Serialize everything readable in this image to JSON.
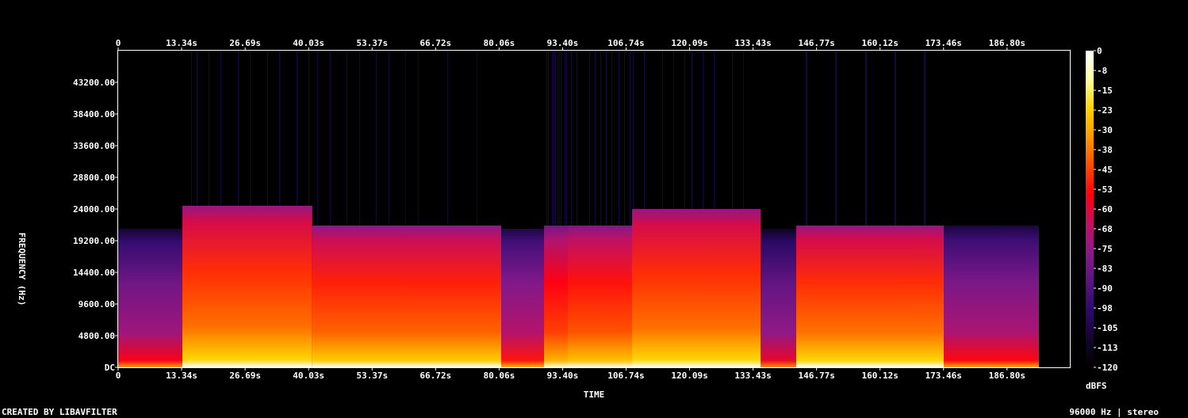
{
  "chart_data": {
    "type": "heatmap",
    "title": "",
    "xlabel": "TIME",
    "ylabel": "FREQUENCY (Hz)",
    "x_ticks": [
      "0",
      "13.34s",
      "26.69s",
      "40.03s",
      "53.37s",
      "66.72s",
      "80.06s",
      "93.40s",
      "106.74s",
      "120.09s",
      "133.43s",
      "146.77s",
      "160.12s",
      "173.46s",
      "186.80s"
    ],
    "y_ticks": [
      "DC",
      "4800.00",
      "9600.00",
      "14400.00",
      "19200.00",
      "24000.00",
      "28800.00",
      "33600.00",
      "38400.00",
      "43200.00"
    ],
    "xlim": [
      0,
      200
    ],
    "ylim": [
      0,
      48000
    ],
    "colorbar": {
      "label": "dBFS",
      "ticks": [
        "0",
        "-8",
        "-15",
        "-23",
        "-30",
        "-38",
        "-45",
        "-53",
        "-60",
        "-68",
        "-75",
        "-83",
        "-90",
        "-98",
        "-105",
        "-113",
        "-120"
      ],
      "range": [
        -120,
        0
      ],
      "colormap": [
        "#000000",
        "#14052e",
        "#2e0a6e",
        "#5a1480",
        "#8a1a8a",
        "#c41060",
        "#ff0010",
        "#ff4a00",
        "#ff9a00",
        "#ffd400",
        "#ffffa0",
        "#ffffff"
      ]
    },
    "segments": [
      {
        "start": 0,
        "end": 13.5,
        "cutoff": 21000,
        "level": -82
      },
      {
        "start": 13.5,
        "end": 40.8,
        "cutoff": 24500,
        "level": -48
      },
      {
        "start": 40.8,
        "end": 80.5,
        "cutoff": 21500,
        "level": -50
      },
      {
        "start": 80.5,
        "end": 89.5,
        "cutoff": 21000,
        "level": -78
      },
      {
        "start": 89.5,
        "end": 94.5,
        "cutoff": 21500,
        "level": -55
      },
      {
        "start": 94.5,
        "end": 108.0,
        "cutoff": 21500,
        "level": -52
      },
      {
        "start": 108.0,
        "end": 135.0,
        "cutoff": 24000,
        "level": -48
      },
      {
        "start": 135.0,
        "end": 142.5,
        "cutoff": 21000,
        "level": -85
      },
      {
        "start": 142.5,
        "end": 173.5,
        "cutoff": 21500,
        "level": -48
      },
      {
        "start": 173.5,
        "end": 193.5,
        "cutoff": 21500,
        "level": -80
      }
    ]
  },
  "footer": {
    "left": "CREATED BY LIBAVFILTER",
    "right": "96000 Hz | stereo"
  }
}
